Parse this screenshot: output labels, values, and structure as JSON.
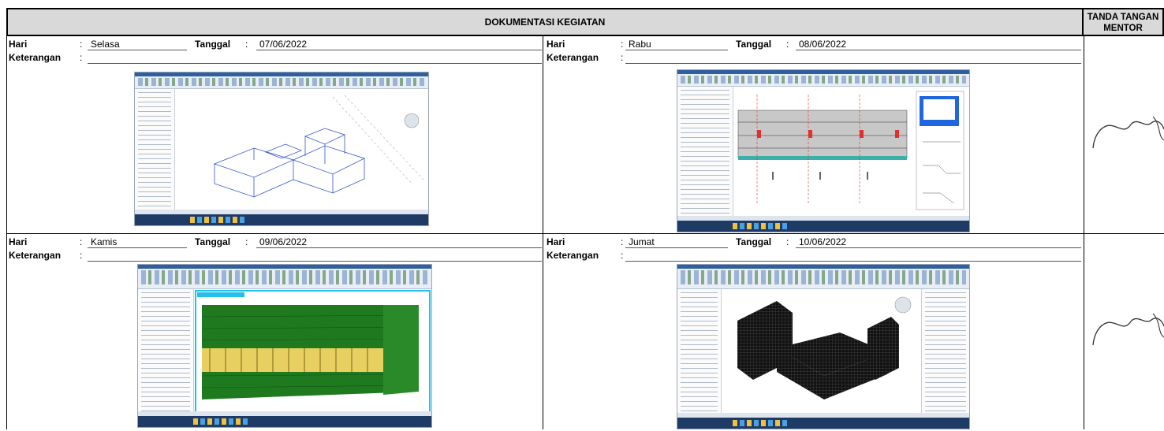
{
  "header": {
    "title": "DOKUMENTASI KEGIATAN",
    "sign_line1": "TANDA TANGAN",
    "sign_line2": "MENTOR"
  },
  "labels": {
    "hari": "Hari",
    "tanggal": "Tanggal",
    "keterangan": "Keterangan",
    "colon": ":"
  },
  "entries": [
    {
      "hari": "Selasa",
      "tanggal": "07/06/2022",
      "keterangan": ""
    },
    {
      "hari": "Rabu",
      "tanggal": "08/06/2022",
      "keterangan": ""
    },
    {
      "hari": "Kamis",
      "tanggal": "09/06/2022",
      "keterangan": ""
    },
    {
      "hari": "Jumat",
      "tanggal": "10/06/2022",
      "keterangan": ""
    }
  ],
  "colors": {
    "header_bg": "#d9d9d9",
    "revit_blue": "#2f5f9e",
    "wireframe": "#3355cc",
    "facade_green": "#1f7a1f",
    "facade_yellow": "#e8d060"
  },
  "icons": {
    "screenshot": "revit-screenshot-image",
    "signature": "mentor-signature"
  }
}
